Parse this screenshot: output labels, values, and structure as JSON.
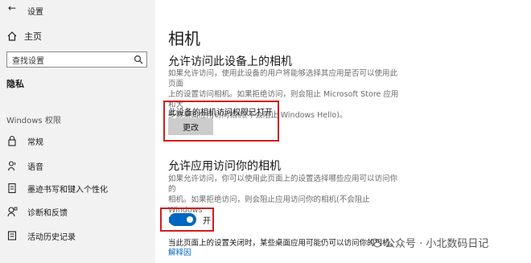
{
  "window": {
    "title": "设置"
  },
  "sidebar": {
    "home_label": "主页",
    "search_placeholder": "查找设置",
    "section_privacy": "隐私",
    "section_windows_permissions": "Windows 权限",
    "items": [
      {
        "label": "常规",
        "icon": "lock-icon"
      },
      {
        "label": "语音",
        "icon": "speech-icon"
      },
      {
        "label": "墨迹书写和键入个性化",
        "icon": "pen-icon"
      },
      {
        "label": "诊断和反馈",
        "icon": "feedback-icon"
      },
      {
        "label": "活动历史记录",
        "icon": "history-icon"
      }
    ]
  },
  "main": {
    "title": "相机",
    "device_access": {
      "heading": "允许访问此设备上的相机",
      "desc_lines": [
        "如果允许访问，使用此设备的用户将能够选择其应用是否可以使用此页面",
        "上的设置访问相机。如果拒绝访问，则会阻止 Microsoft Store 应用和大",
        "多数桌面应用访问相机(不会阻止 Windows Hello)。"
      ],
      "status_text": "此设备的相机访问权限已打开",
      "change_button": "更改"
    },
    "app_access": {
      "heading": "允许应用访问你的相机",
      "desc_lines": [
        "如果允许访问，你可以使用此页面上的设置选择哪些应用可以访问你的",
        "相机。如果拒绝访问，则会阻止应用访问你的相机(不会阻止 Windows",
        "Hello)。"
      ],
      "toggle_label": "开",
      "toggle_on": true
    },
    "note_text": "当此页面上的设置关闭时，某些桌面应用可能仍可以访问你的相机。",
    "learn_link": "解释因"
  },
  "watermark": {
    "text": "公众号 · 小北数码日记"
  },
  "colors": {
    "accent": "#0067c0",
    "highlight": "#d21d1d",
    "sidebar_bg": "#f2f2f2"
  }
}
